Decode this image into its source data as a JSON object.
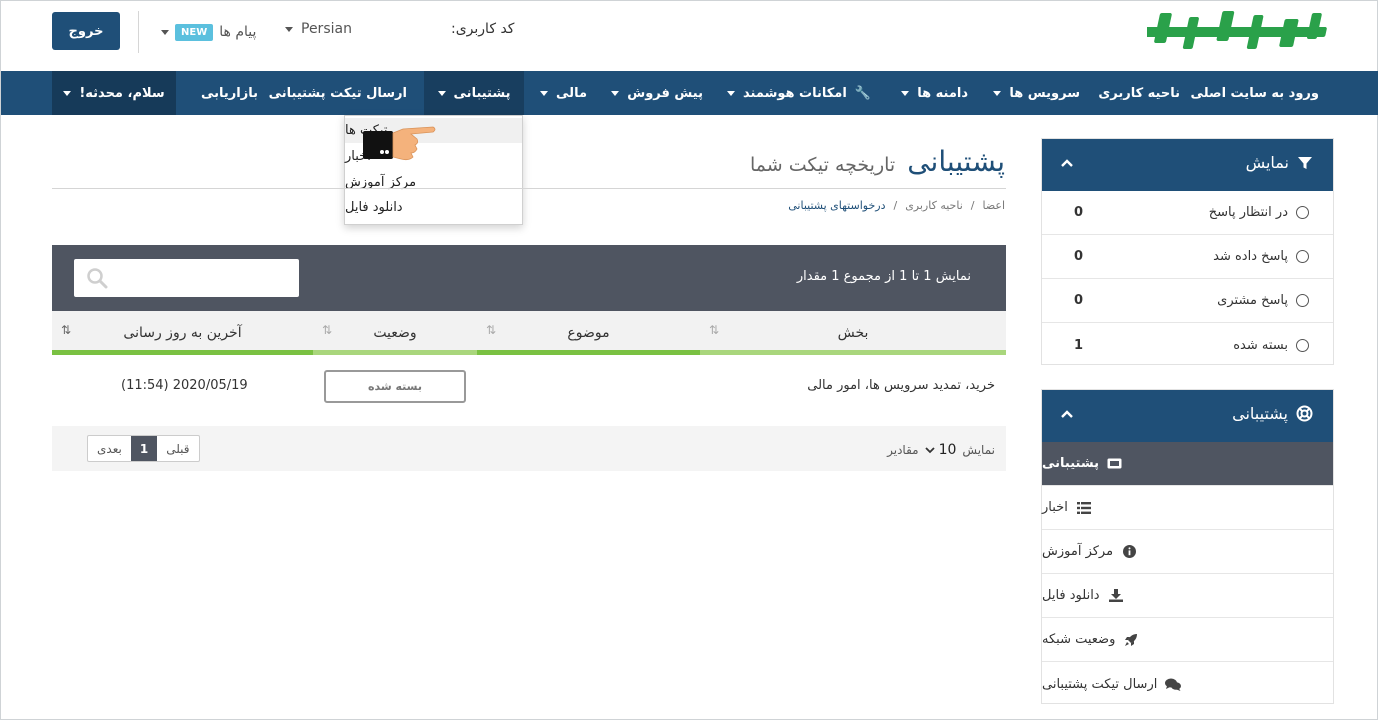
{
  "header": {
    "logout": "خروج",
    "messages": "پیام ها",
    "new_badge": "NEW",
    "language": "Persian",
    "user_code": "کد کاربری:"
  },
  "nav": {
    "home": "ورود به سایت اصلی",
    "client_area": "ناحیه کاربری",
    "services": "سرویس ها",
    "domains": "دامنه ها",
    "smart": "امکانات هوشمند",
    "presale": "پیش فروش",
    "finance": "مالی",
    "support": "پشتیبانی",
    "open_ticket": "ارسال تیکت پشتیبانی",
    "affiliate": "بازاریابی",
    "greeting": "سلام، محدثه!"
  },
  "dropdown": {
    "items": [
      "تیکت ها",
      "اخبار",
      "مرکز آموزش",
      "دانلود فایل"
    ]
  },
  "page": {
    "title": "پشتیبانی",
    "subtitle": "تاریخچه تیکت شما",
    "breadcrumb": [
      "اعضا",
      "ناحیه کاربری",
      "درخواستهای پشتیبانی"
    ],
    "sep": "/"
  },
  "table": {
    "info": "نمایش 1 تا 1 از مجموع 1 مقدار",
    "headers": [
      "بخش",
      "موضوع",
      "وضعیت",
      "آخرین به روز رسانی"
    ],
    "rows": [
      {
        "department": "خرید، تمدید سرویس ها، امور مالی",
        "subject": "",
        "status": "بسته شده",
        "updated": "(11:54) 2020/05/19"
      }
    ],
    "show_label": "نمایش",
    "per_page": "10",
    "entries_label": "مقادیر",
    "prev": "قبلی",
    "page": "1",
    "next": "بعدی"
  },
  "filter_panel": {
    "title": "نمایش",
    "items": [
      {
        "label": "در انتظار پاسخ",
        "count": "0"
      },
      {
        "label": "پاسخ داده شد",
        "count": "0"
      },
      {
        "label": "پاسخ مشتری",
        "count": "0"
      },
      {
        "label": "بسته شده",
        "count": "1"
      }
    ]
  },
  "support_panel": {
    "title": "پشتیبانی",
    "items": [
      {
        "label": "پشتیبانی",
        "icon": "ticket-icon"
      },
      {
        "label": "اخبار",
        "icon": "list-icon"
      },
      {
        "label": "مرکز آموزش",
        "icon": "info-icon"
      },
      {
        "label": "دانلود فایل",
        "icon": "download-icon"
      },
      {
        "label": "وضعیت شبکه",
        "icon": "rocket-icon"
      },
      {
        "label": "ارسال تیکت پشتیبانی",
        "icon": "comments-icon"
      }
    ]
  },
  "colors": {
    "primary": "#1f4f78",
    "dark_bar": "#4f5561",
    "green": "#7ac142",
    "light_green": "#a9d67c",
    "logo_green": "#2aa14a"
  }
}
